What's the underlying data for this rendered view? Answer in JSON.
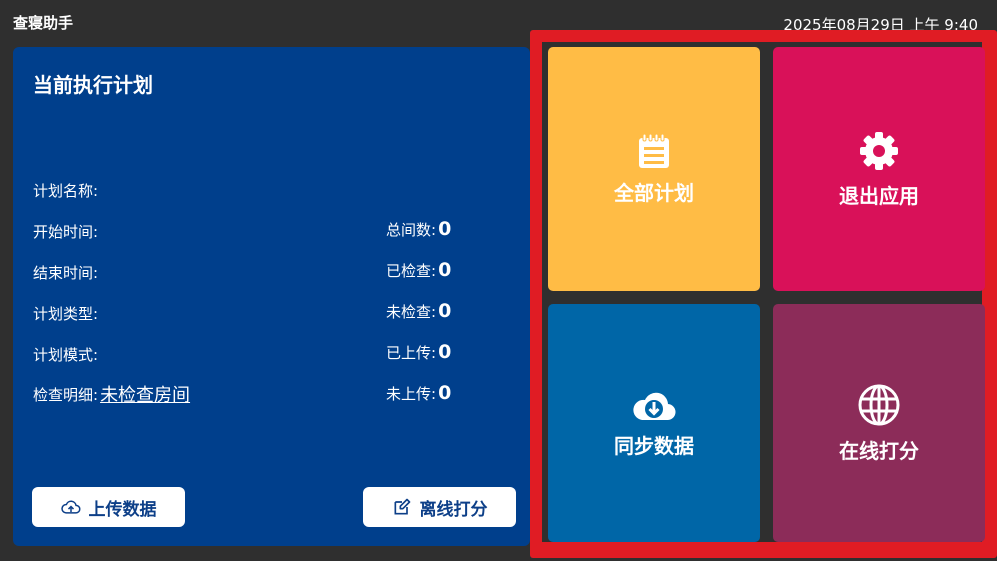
{
  "status_bar": {
    "app_title": "查寝助手",
    "datetime": "2025年08月29日 上午 9:40"
  },
  "plan": {
    "title": "当前执行计划",
    "name_label": "计划名称:",
    "start_label": "开始时间:",
    "end_label": "结束时间:",
    "type_label": "计划类型:",
    "mode_label": "计划模式:",
    "detail_label": "检查明细:",
    "detail_link": "未检查房间",
    "stats": [
      {
        "label": "总间数:",
        "value": "0"
      },
      {
        "label": "已检查:",
        "value": "0"
      },
      {
        "label": "未检查:",
        "value": "0"
      },
      {
        "label": "已上传:",
        "value": "0"
      },
      {
        "label": "未上传:",
        "value": "0"
      }
    ],
    "upload_button": "上传数据",
    "offline_button": "离线打分"
  },
  "tiles": {
    "all_plans": {
      "label": "全部计划",
      "icon": "notepad-icon",
      "color": "#ffbc45"
    },
    "exit_app": {
      "label": "退出应用",
      "icon": "gear-icon",
      "color": "#d91159"
    },
    "sync_data": {
      "label": "同步数据",
      "icon": "cloud-download-icon",
      "color": "#0066a7"
    },
    "online_score": {
      "label": "在线打分",
      "icon": "globe-icon",
      "color": "#8c2c59"
    }
  },
  "colors": {
    "panel": "#003f8c",
    "highlight_frame": "#e01c24",
    "background": "#2f2f2f"
  }
}
